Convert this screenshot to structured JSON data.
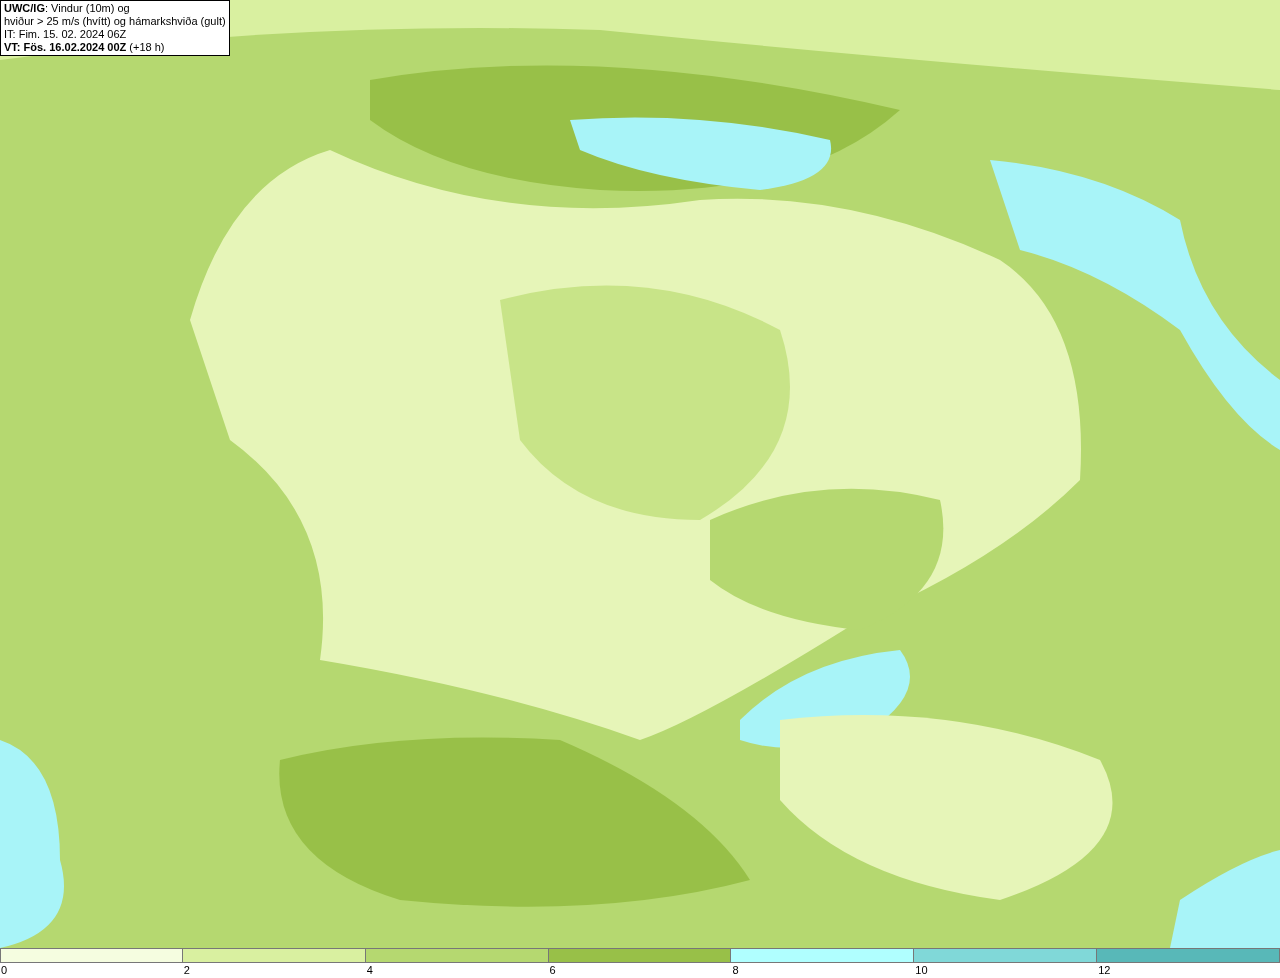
{
  "info_box": {
    "lines": [
      "**UWC/IG**: Vindur (10m) og",
      "hviður > 25 m/s (hvítt) og hámarkshviða (gult)",
      "IT: Fim. 15. 02. 2024 06Z",
      "**VT: Fös. 16.02.2024 00Z** (+18 h)"
    ]
  },
  "legend": {
    "bins": [
      {
        "color": "#f5fde0",
        "label": "0"
      },
      {
        "color": "#d9f0a0",
        "label": "2"
      },
      {
        "color": "#b5d870",
        "label": "4"
      },
      {
        "color": "#98c048",
        "label": "6"
      },
      {
        "color": "#b0ffff",
        "label": "8"
      },
      {
        "color": "#80d8d8",
        "label": "10"
      },
      {
        "color": "#58b8b8",
        "label": "12"
      }
    ]
  }
}
